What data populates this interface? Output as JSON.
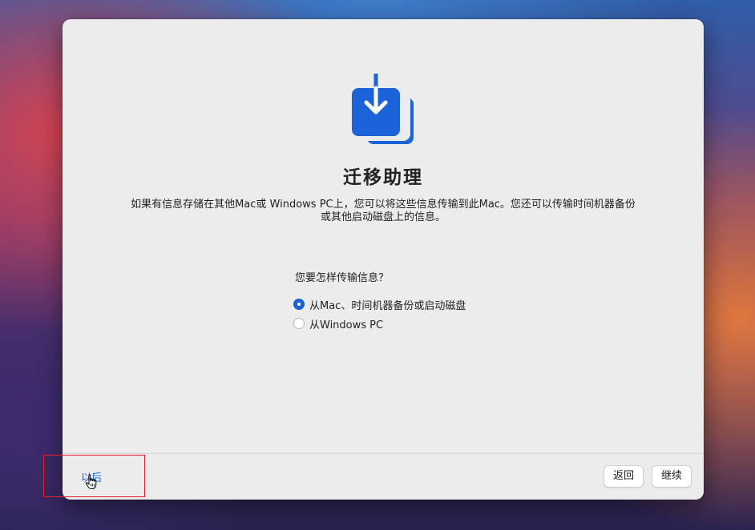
{
  "window": {
    "app_icon": "migration-assistant-icon",
    "title": "迁移助理",
    "description": "如果有信息存储在其他Mac或 Windows PC上，您可以将这些信息传输到此Mac。您还可以传输时间机器备份或其他启动磁盘上的信息。",
    "question": "您要怎样传输信息？",
    "options": [
      {
        "label": "从Mac、时间机器备份或启动磁盘",
        "selected": true
      },
      {
        "label": "从Windows PC",
        "selected": false
      }
    ]
  },
  "footer": {
    "later_label": "以后",
    "back_label": "返回",
    "continue_label": "继续"
  },
  "colors": {
    "accent": "#1a63d8",
    "highlight": "#e0202a",
    "window_bg": "#ececec"
  }
}
